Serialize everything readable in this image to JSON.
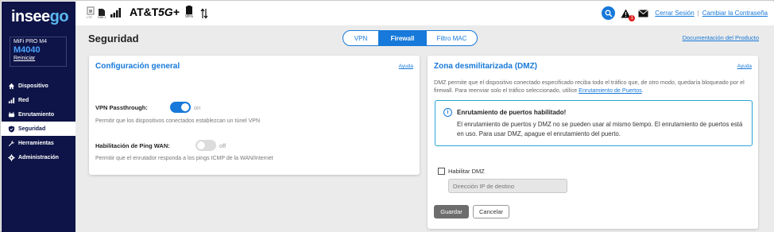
{
  "sidebar": {
    "logo_text_a": "insee",
    "logo_text_b": "go",
    "device_model": "MiFi PRO M4",
    "device_name": "M4040",
    "reboot_label": "Reiniciar",
    "items": [
      {
        "label": "Dispositivo",
        "icon": "home-icon"
      },
      {
        "label": "Red",
        "icon": "signal-bars-icon"
      },
      {
        "label": "Enrutamiento",
        "icon": "routing-icon"
      },
      {
        "label": "Seguridad",
        "icon": "shield-icon",
        "active": true
      },
      {
        "label": "Herramientas",
        "icon": "wrench-icon"
      },
      {
        "label": "Administración",
        "icon": "gear-icon"
      }
    ]
  },
  "topbar": {
    "sim_label": "SIM 1",
    "carrier": "AT&T",
    "network": "5G+",
    "battery_percent": "98%",
    "alert_count": "1",
    "logout_label": "Cerrar Sesión",
    "change_password_label": "Cambiar la Contraseña",
    "separator": "|"
  },
  "page": {
    "title": "Seguridad",
    "tabs": [
      "VPN",
      "Firewall",
      "Filtro MAC"
    ],
    "active_tab": "Firewall",
    "doc_link": "Documentación del Producto"
  },
  "general": {
    "title": "Configuración general",
    "help": "Ayuda",
    "vpn_label": "VPN Passthrough:",
    "vpn_state": "on",
    "vpn_desc": "Permitir que los dispositivos conectados establezcan un túnel VPN",
    "ping_label": "Habilitación de Ping WAN:",
    "ping_state": "off",
    "ping_desc": "Permitir que el enrutador responda a los pings ICMP de la WAN/Internet"
  },
  "dmz": {
    "title": "Zona desmilitarizada (DMZ)",
    "help": "Ayuda",
    "desc_a": "DMZ permite que el dispositivo conectado especificado reciba todo el tráfico que, de otro modo, quedaría bloqueado por el firewall. Para reenviar solo el tráfico seleccionado, utilice ",
    "desc_link": "Enrutamiento de Puertos",
    "desc_b": ".",
    "alert_title": "Enrutamiento de puertos habilitado!",
    "alert_body": "El enrutamiento de puertos y DMZ no se pueden usar al mismo tiempo. El enrutamiento de puertos está en uso. Para usar DMZ, apague el enrutamiento del puerto.",
    "enable_label": "Habilitar DMZ",
    "ip_placeholder": "Dirección IP de destino",
    "save_label": "Guardar",
    "cancel_label": "Cancelar"
  },
  "colors": {
    "sidebar_bg": "#0e1447",
    "accent": "#1779d9",
    "alert_border": "#2aa6d6"
  }
}
